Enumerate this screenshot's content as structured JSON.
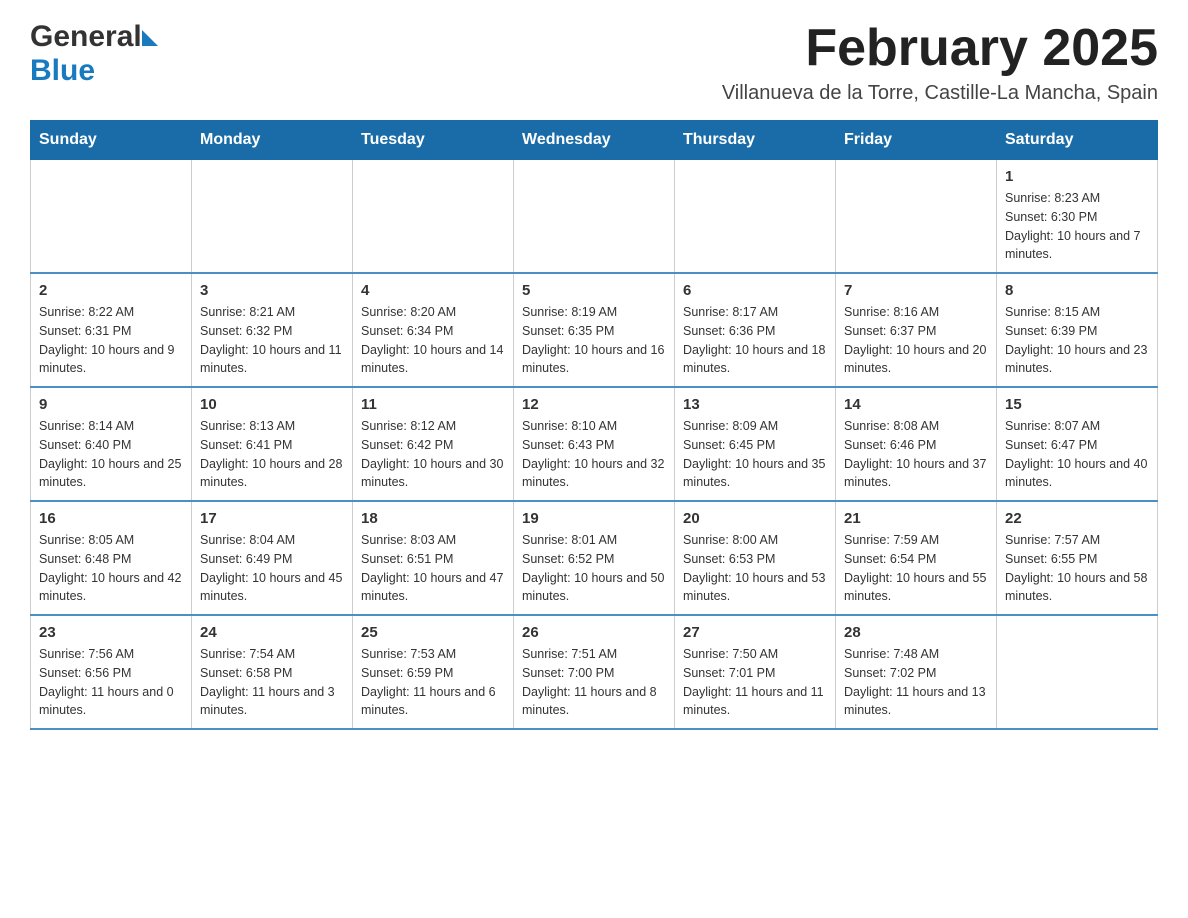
{
  "header": {
    "logo_general": "General",
    "logo_blue": "Blue",
    "month_title": "February 2025",
    "location": "Villanueva de la Torre, Castille-La Mancha, Spain"
  },
  "weekdays": [
    "Sunday",
    "Monday",
    "Tuesday",
    "Wednesday",
    "Thursday",
    "Friday",
    "Saturday"
  ],
  "weeks": [
    {
      "days": [
        {
          "number": "",
          "info": ""
        },
        {
          "number": "",
          "info": ""
        },
        {
          "number": "",
          "info": ""
        },
        {
          "number": "",
          "info": ""
        },
        {
          "number": "",
          "info": ""
        },
        {
          "number": "",
          "info": ""
        },
        {
          "number": "1",
          "info": "Sunrise: 8:23 AM\nSunset: 6:30 PM\nDaylight: 10 hours and 7 minutes."
        }
      ]
    },
    {
      "days": [
        {
          "number": "2",
          "info": "Sunrise: 8:22 AM\nSunset: 6:31 PM\nDaylight: 10 hours and 9 minutes."
        },
        {
          "number": "3",
          "info": "Sunrise: 8:21 AM\nSunset: 6:32 PM\nDaylight: 10 hours and 11 minutes."
        },
        {
          "number": "4",
          "info": "Sunrise: 8:20 AM\nSunset: 6:34 PM\nDaylight: 10 hours and 14 minutes."
        },
        {
          "number": "5",
          "info": "Sunrise: 8:19 AM\nSunset: 6:35 PM\nDaylight: 10 hours and 16 minutes."
        },
        {
          "number": "6",
          "info": "Sunrise: 8:17 AM\nSunset: 6:36 PM\nDaylight: 10 hours and 18 minutes."
        },
        {
          "number": "7",
          "info": "Sunrise: 8:16 AM\nSunset: 6:37 PM\nDaylight: 10 hours and 20 minutes."
        },
        {
          "number": "8",
          "info": "Sunrise: 8:15 AM\nSunset: 6:39 PM\nDaylight: 10 hours and 23 minutes."
        }
      ]
    },
    {
      "days": [
        {
          "number": "9",
          "info": "Sunrise: 8:14 AM\nSunset: 6:40 PM\nDaylight: 10 hours and 25 minutes."
        },
        {
          "number": "10",
          "info": "Sunrise: 8:13 AM\nSunset: 6:41 PM\nDaylight: 10 hours and 28 minutes."
        },
        {
          "number": "11",
          "info": "Sunrise: 8:12 AM\nSunset: 6:42 PM\nDaylight: 10 hours and 30 minutes."
        },
        {
          "number": "12",
          "info": "Sunrise: 8:10 AM\nSunset: 6:43 PM\nDaylight: 10 hours and 32 minutes."
        },
        {
          "number": "13",
          "info": "Sunrise: 8:09 AM\nSunset: 6:45 PM\nDaylight: 10 hours and 35 minutes."
        },
        {
          "number": "14",
          "info": "Sunrise: 8:08 AM\nSunset: 6:46 PM\nDaylight: 10 hours and 37 minutes."
        },
        {
          "number": "15",
          "info": "Sunrise: 8:07 AM\nSunset: 6:47 PM\nDaylight: 10 hours and 40 minutes."
        }
      ]
    },
    {
      "days": [
        {
          "number": "16",
          "info": "Sunrise: 8:05 AM\nSunset: 6:48 PM\nDaylight: 10 hours and 42 minutes."
        },
        {
          "number": "17",
          "info": "Sunrise: 8:04 AM\nSunset: 6:49 PM\nDaylight: 10 hours and 45 minutes."
        },
        {
          "number": "18",
          "info": "Sunrise: 8:03 AM\nSunset: 6:51 PM\nDaylight: 10 hours and 47 minutes."
        },
        {
          "number": "19",
          "info": "Sunrise: 8:01 AM\nSunset: 6:52 PM\nDaylight: 10 hours and 50 minutes."
        },
        {
          "number": "20",
          "info": "Sunrise: 8:00 AM\nSunset: 6:53 PM\nDaylight: 10 hours and 53 minutes."
        },
        {
          "number": "21",
          "info": "Sunrise: 7:59 AM\nSunset: 6:54 PM\nDaylight: 10 hours and 55 minutes."
        },
        {
          "number": "22",
          "info": "Sunrise: 7:57 AM\nSunset: 6:55 PM\nDaylight: 10 hours and 58 minutes."
        }
      ]
    },
    {
      "days": [
        {
          "number": "23",
          "info": "Sunrise: 7:56 AM\nSunset: 6:56 PM\nDaylight: 11 hours and 0 minutes."
        },
        {
          "number": "24",
          "info": "Sunrise: 7:54 AM\nSunset: 6:58 PM\nDaylight: 11 hours and 3 minutes."
        },
        {
          "number": "25",
          "info": "Sunrise: 7:53 AM\nSunset: 6:59 PM\nDaylight: 11 hours and 6 minutes."
        },
        {
          "number": "26",
          "info": "Sunrise: 7:51 AM\nSunset: 7:00 PM\nDaylight: 11 hours and 8 minutes."
        },
        {
          "number": "27",
          "info": "Sunrise: 7:50 AM\nSunset: 7:01 PM\nDaylight: 11 hours and 11 minutes."
        },
        {
          "number": "28",
          "info": "Sunrise: 7:48 AM\nSunset: 7:02 PM\nDaylight: 11 hours and 13 minutes."
        },
        {
          "number": "",
          "info": ""
        }
      ]
    }
  ]
}
